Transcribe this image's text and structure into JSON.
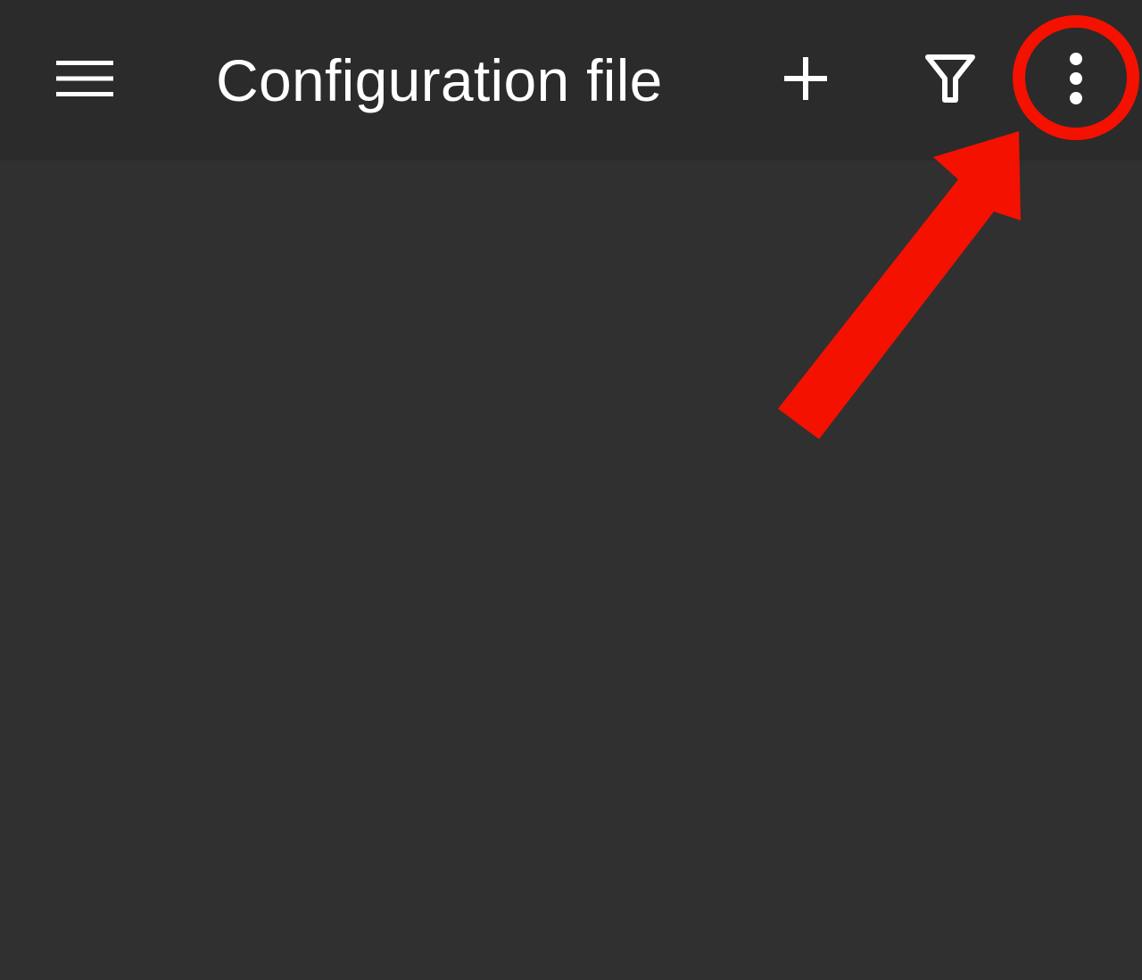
{
  "app_bar": {
    "title": "Configuration file",
    "icons": {
      "menu": "hamburger-menu-icon",
      "add": "plus-icon",
      "filter": "filter-icon",
      "more": "more-vertical-icon"
    }
  },
  "colors": {
    "app_bar_background": "#2b2b2b",
    "content_background": "#303030",
    "icon_color": "#ffffff",
    "annotation_color": "#f41100"
  },
  "annotation": {
    "shapes": [
      "circle",
      "arrow"
    ],
    "target": "more-options-button"
  }
}
